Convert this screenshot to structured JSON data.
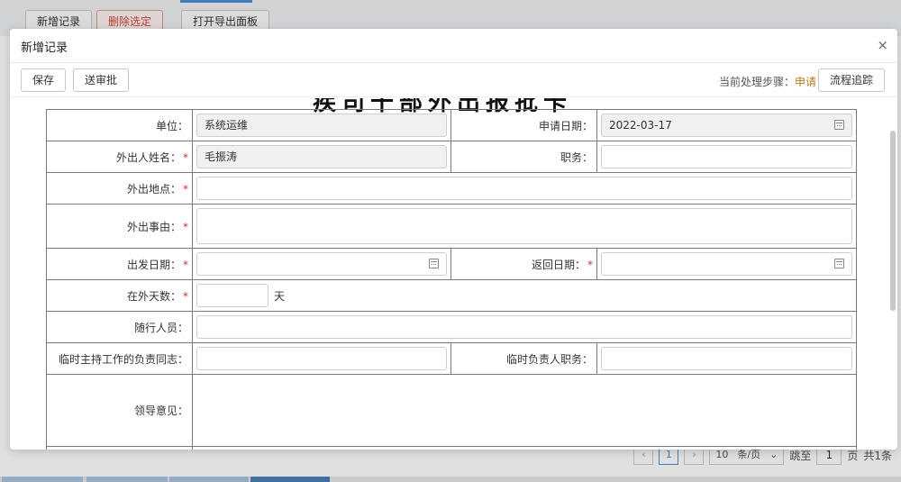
{
  "background": {
    "toolbar": {
      "add_label": "新增记录",
      "delete_label": "删除选定",
      "export_label": "打开导出面板"
    },
    "pager": {
      "prev": "‹",
      "current_page": "1",
      "next": "›",
      "page_size": "10",
      "page_size_unit": "条/页",
      "goto_label": "跳至",
      "goto_value": "1",
      "page_unit": "页",
      "total": "共1条"
    }
  },
  "dialog": {
    "title": "新增记录",
    "close_icon": "close-icon",
    "toolbar": {
      "save_label": "保存",
      "submit_label": "送审批",
      "step_label": "当前处理步骤：",
      "step_value": "申请",
      "trace_label": "流程追踪"
    },
    "form": {
      "title_partial": "疾司干部外出报批卡",
      "fields": {
        "unit_label": "单位：",
        "unit_value": "系统运维",
        "apply_date_label": "申请日期：",
        "apply_date_value": "2022-03-17",
        "name_label": "外出人姓名：",
        "name_value": "毛振涛",
        "position_label": "职务：",
        "position_value": "",
        "place_label": "外出地点：",
        "place_value": "",
        "reason_label": "外出事由：",
        "reason_value": "",
        "depart_label": "出发日期：",
        "depart_value": "",
        "return_label": "返回日期：",
        "return_value": "",
        "days_label": "在外天数：",
        "days_value": "",
        "days_unit": "天",
        "companions_label": "随行人员：",
        "companions_value": "",
        "acting_label": "临时主持工作的负责同志：",
        "acting_value": "",
        "acting_position_label": "临时负责人职务：",
        "acting_position_value": "",
        "leader_opinion_label": "领导意见："
      },
      "required_mark": "*"
    }
  },
  "colors": {
    "danger": "#d4453b",
    "accent": "#4a8fd6",
    "step_value": "#b87a1a",
    "required": "#d0342c"
  }
}
